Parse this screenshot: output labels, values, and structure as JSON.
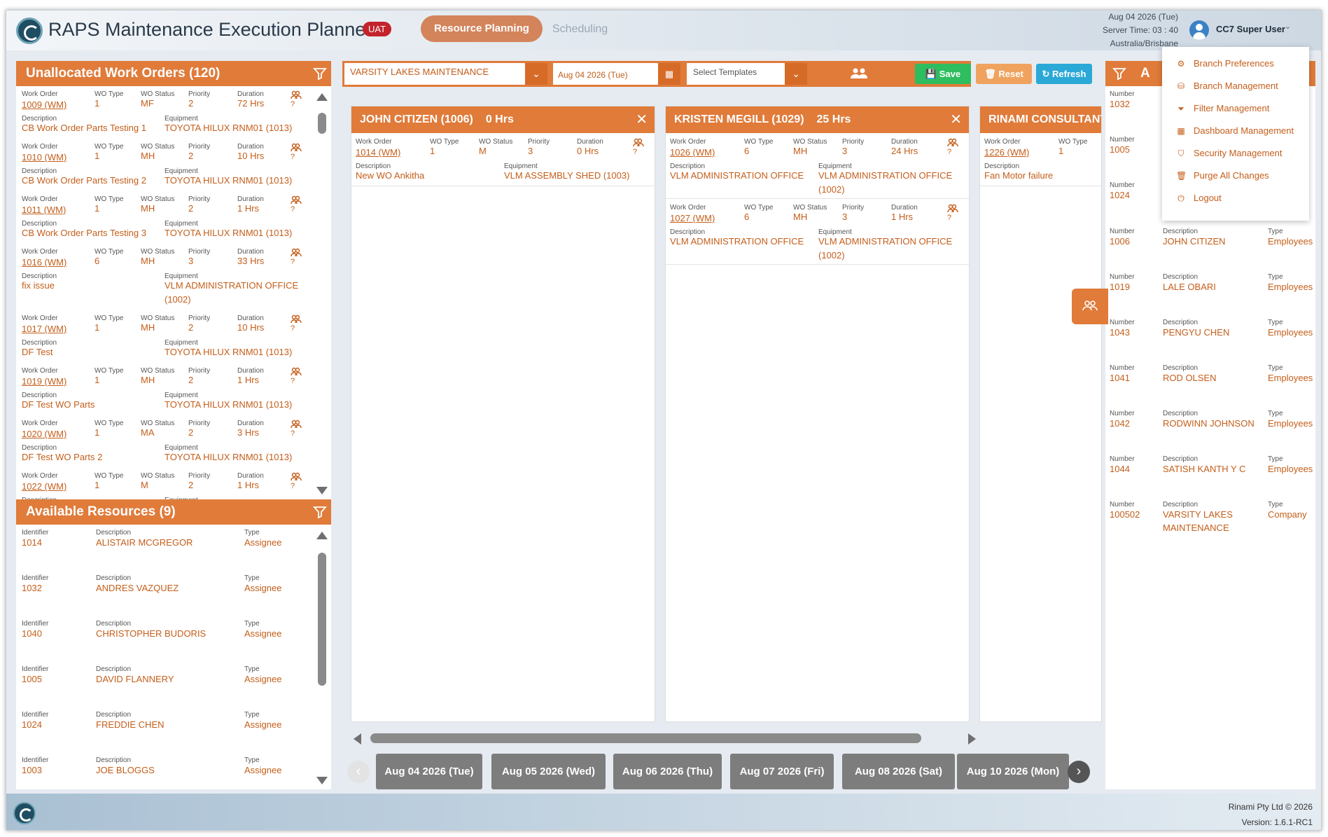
{
  "header": {
    "app_title": "RAPS Maintenance Execution Planner",
    "env_badge": "UAT",
    "tabs": [
      {
        "label": "Resource Planning",
        "active": true
      },
      {
        "label": "Scheduling",
        "active": false
      }
    ],
    "server_date": "Aug 04 2026 (Tue)",
    "server_time": "Server Time: 03 : 40",
    "server_tz": "Australia/Brisbane",
    "user_name": "CC7 Super User"
  },
  "unallocated": {
    "title": "Unallocated Work Orders (120)",
    "labels": {
      "work_order": "Work Order",
      "wo_type": "WO Type",
      "wo_status": "WO Status",
      "priority": "Priority",
      "duration": "Duration",
      "description": "Description",
      "equipment": "Equipment"
    },
    "items": [
      {
        "wo": "1009 (WM)",
        "type": "1",
        "status": "MF",
        "priority": "2",
        "duration": "72 Hrs",
        "description": "CB Work Order Parts Testing 1",
        "equipment": "TOYOTA HILUX RNM01 (1013)",
        "equipment2": ""
      },
      {
        "wo": "1010 (WM)",
        "type": "1",
        "status": "MH",
        "priority": "2",
        "duration": "10 Hrs",
        "description": "CB Work Order Parts Testing 2",
        "equipment": "TOYOTA HILUX RNM01 (1013)",
        "equipment2": ""
      },
      {
        "wo": "1011 (WM)",
        "type": "1",
        "status": "MH",
        "priority": "2",
        "duration": "1 Hrs",
        "description": "CB Work Order Parts Testing 3",
        "equipment": "TOYOTA HILUX RNM01 (1013)",
        "equipment2": ""
      },
      {
        "wo": "1016 (WM)",
        "type": "6",
        "status": "MH",
        "priority": "3",
        "duration": "33 Hrs",
        "description": "fix issue",
        "equipment": "VLM ADMINISTRATION OFFICE",
        "equipment2": "(1002)"
      },
      {
        "wo": "1017 (WM)",
        "type": "1",
        "status": "MH",
        "priority": "2",
        "duration": "10 Hrs",
        "description": "DF Test",
        "equipment": "TOYOTA HILUX RNM01 (1013)",
        "equipment2": ""
      },
      {
        "wo": "1019 (WM)",
        "type": "1",
        "status": "MH",
        "priority": "2",
        "duration": "1 Hrs",
        "description": "DF Test WO Parts",
        "equipment": "TOYOTA HILUX RNM01 (1013)",
        "equipment2": ""
      },
      {
        "wo": "1020 (WM)",
        "type": "1",
        "status": "MA",
        "priority": "2",
        "duration": "3 Hrs",
        "description": "DF Test WO Parts 2",
        "equipment": "TOYOTA HILUX RNM01 (1013)",
        "equipment2": ""
      },
      {
        "wo": "1022 (WM)",
        "type": "1",
        "status": "M",
        "priority": "2",
        "duration": "1 Hrs",
        "description": "",
        "equipment": "",
        "equipment2": ""
      }
    ]
  },
  "resources": {
    "title": "Available Resources (9)",
    "labels": {
      "identifier": "Identifier",
      "description": "Description",
      "type": "Type"
    },
    "items": [
      {
        "id": "1014",
        "description": "ALISTAIR MCGREGOR",
        "type": "Assignee"
      },
      {
        "id": "1032",
        "description": "ANDRES VAZQUEZ",
        "type": "Assignee"
      },
      {
        "id": "1040",
        "description": "CHRISTOPHER BUDORIS",
        "type": "Assignee"
      },
      {
        "id": "1005",
        "description": "DAVID FLANNERY",
        "type": "Assignee"
      },
      {
        "id": "1024",
        "description": "FREDDIE CHEN",
        "type": "Assignee"
      },
      {
        "id": "1003",
        "description": "JOE BLOGGS",
        "type": "Assignee"
      }
    ]
  },
  "toolbar": {
    "branch": "VARSITY LAKES MAINTENANCE",
    "date": "Aug 04 2026 (Tue)",
    "template_placeholder": "Select Templates",
    "save": "Save",
    "reset": "Reset",
    "refresh": "Refresh"
  },
  "columns": [
    {
      "title": "JOHN CITIZEN (1006)",
      "hours": "0 Hrs",
      "orders": [
        {
          "wo": "1014 (WM)",
          "type": "1",
          "status": "M",
          "priority": "3",
          "duration": "0 Hrs",
          "description": "New WO Ankitha",
          "equipment": "VLM ASSEMBLY SHED (1003)",
          "equipment2": ""
        }
      ]
    },
    {
      "title": "KRISTEN MEGILL (1029)",
      "hours": "25 Hrs",
      "orders": [
        {
          "wo": "1026 (WM)",
          "type": "6",
          "status": "MH",
          "priority": "3",
          "duration": "24 Hrs",
          "description": "VLM ADMINISTRATION OFFICE",
          "equipment": "VLM ADMINISTRATION OFFICE",
          "equipment2": "(1002)"
        },
        {
          "wo": "1027 (WM)",
          "type": "6",
          "status": "MH",
          "priority": "3",
          "duration": "1 Hrs",
          "description": "VLM ADMINISTRATION OFFICE",
          "equipment": "VLM ADMINISTRATION OFFICE",
          "equipment2": "(1002)"
        }
      ]
    },
    {
      "title": "RINAMI CONSULTANT",
      "hours": "",
      "orders": [
        {
          "wo": "1226 (WM)",
          "type": "1",
          "status": "",
          "priority": "",
          "duration": "",
          "description": "Fan Motor failure",
          "equipment": "",
          "equipment2": ""
        }
      ]
    }
  ],
  "dates": [
    "Aug 04 2026 (Tue)",
    "Aug 05 2026 (Wed)",
    "Aug 06 2026 (Thu)",
    "Aug 07 2026 (Fri)",
    "Aug 08 2026 (Sat)",
    "Aug 10 2026 (Mon)"
  ],
  "right_panel": {
    "title_initial": "A",
    "labels": {
      "number": "Number",
      "description": "Description",
      "type": "Type"
    },
    "partial": [
      {
        "number": "1032"
      },
      {
        "number": "1005"
      },
      {
        "number": "1024"
      }
    ],
    "items": [
      {
        "number": "1006",
        "description": "JOHN CITIZEN",
        "description2": "",
        "type": "Employees"
      },
      {
        "number": "1019",
        "description": "LALE OBARI",
        "description2": "",
        "type": "Employees"
      },
      {
        "number": "1043",
        "description": "PENGYU CHEN",
        "description2": "",
        "type": "Employees"
      },
      {
        "number": "1041",
        "description": "ROD OLSEN",
        "description2": "",
        "type": "Employees"
      },
      {
        "number": "1042",
        "description": "RODWINN JOHNSON",
        "description2": "",
        "type": "Employees"
      },
      {
        "number": "1044",
        "description": "SATISH KANTH Y C",
        "description2": "",
        "type": "Employees"
      },
      {
        "number": "100502",
        "description": "VARSITY LAKES",
        "description2": "MAINTENANCE",
        "type": "Company"
      }
    ]
  },
  "user_menu": [
    {
      "label": "Branch Preferences",
      "icon": "gear-icon"
    },
    {
      "label": "Branch Management",
      "icon": "sitemap-icon"
    },
    {
      "label": "Filter Management",
      "icon": "filter-icon"
    },
    {
      "label": "Dashboard Management",
      "icon": "grid-icon"
    },
    {
      "label": "Security Management",
      "icon": "shield-icon"
    },
    {
      "label": "Purge All Changes",
      "icon": "trash-icon"
    },
    {
      "label": "Logout",
      "icon": "power-icon"
    }
  ],
  "footer": {
    "copyright": "Rinami Pty Ltd © 2026",
    "version": "Version: 1.6.1-RC1"
  },
  "colors": {
    "accent": "#e07b3a",
    "accent_text": "#c45e1a",
    "save": "#2ebd5f",
    "reset": "#f0a35f",
    "refresh": "#2ba9d6",
    "date_btn": "#7d7d7d"
  }
}
